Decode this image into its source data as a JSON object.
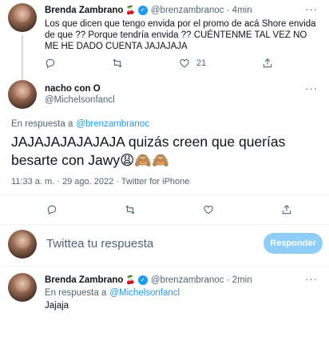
{
  "tweet1": {
    "display_name": "Brenda Zambrano",
    "badge_emoji": "🍒",
    "handle_time": "@brenzambranoc · 4min",
    "text": "Los que dicen que tengo envida por el promo de acá Shore envida de que ?? Porque tendría envida ?? CUÉNTENME TAL VEZ NO ME HE DADO CUENTA JAJAJAJA",
    "likes": "21"
  },
  "tweet2": {
    "display_name": "nacho con O",
    "handle": "@Michelsonfancl",
    "reply_prefix": "En respuesta a",
    "reply_to": "@brenzambranoc",
    "text": "JAJAJAJAJAJAJA quizás creen que querías besarte con Jawy😩🙈🙈",
    "meta": "11:33 a. m. · 29 ago. 2022 · Twitter for iPhone"
  },
  "composer": {
    "placeholder": "Twittea tu respuesta",
    "button": "Responder"
  },
  "tweet3": {
    "display_name": "Brenda Zambrano",
    "badge_emoji": "🍒",
    "handle_time": "@brenzambranoc · 2min",
    "reply_prefix": "En respuesta a",
    "reply_to": "@Michelsonfancl",
    "text": "Jajaja"
  },
  "colors": {
    "accent": "#1d9bf0",
    "text": "#0f1419",
    "muted": "#536471",
    "button_disabled": "#8ecdf8"
  }
}
